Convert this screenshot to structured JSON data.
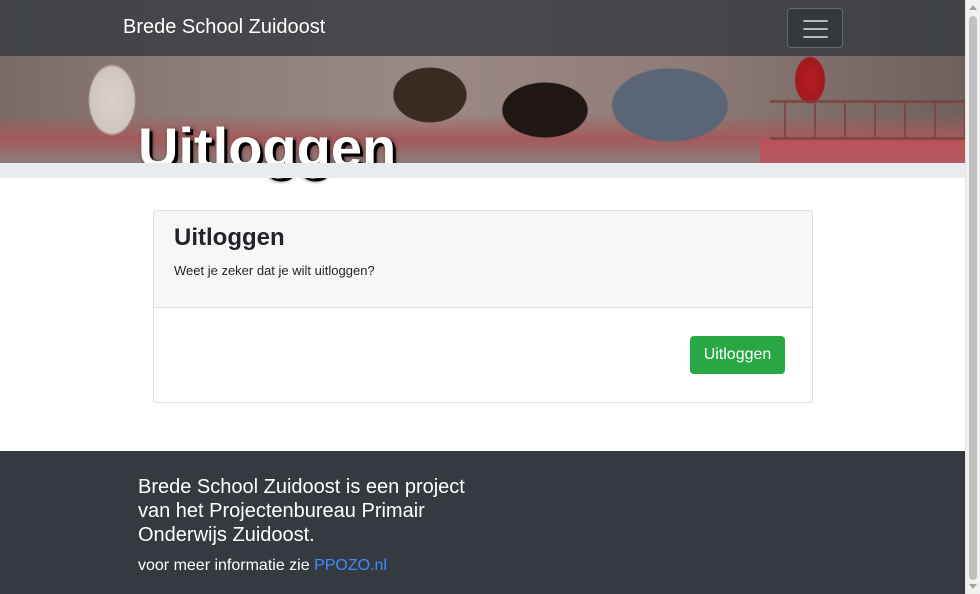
{
  "navbar": {
    "brand": "Brede School Zuidoost",
    "toggler_icon": "hamburger-icon"
  },
  "hero": {
    "title": "Uitloggen"
  },
  "card": {
    "title": "Uitloggen",
    "text": "Weet je zeker dat je wilt uitloggen?",
    "button_label": "Uitloggen"
  },
  "footer": {
    "description": "Brede School Zuidoost is een project van het Projectenbureau Primair Onderwijs Zuidoost.",
    "more_info_prefix": "voor meer informatie zie ",
    "link_text": "PPOZO.nl"
  },
  "colors": {
    "navbar_bg": "#343a40",
    "button_success": "#28a745",
    "footer_bg": "#343a40",
    "link": "#3d8bfd"
  }
}
